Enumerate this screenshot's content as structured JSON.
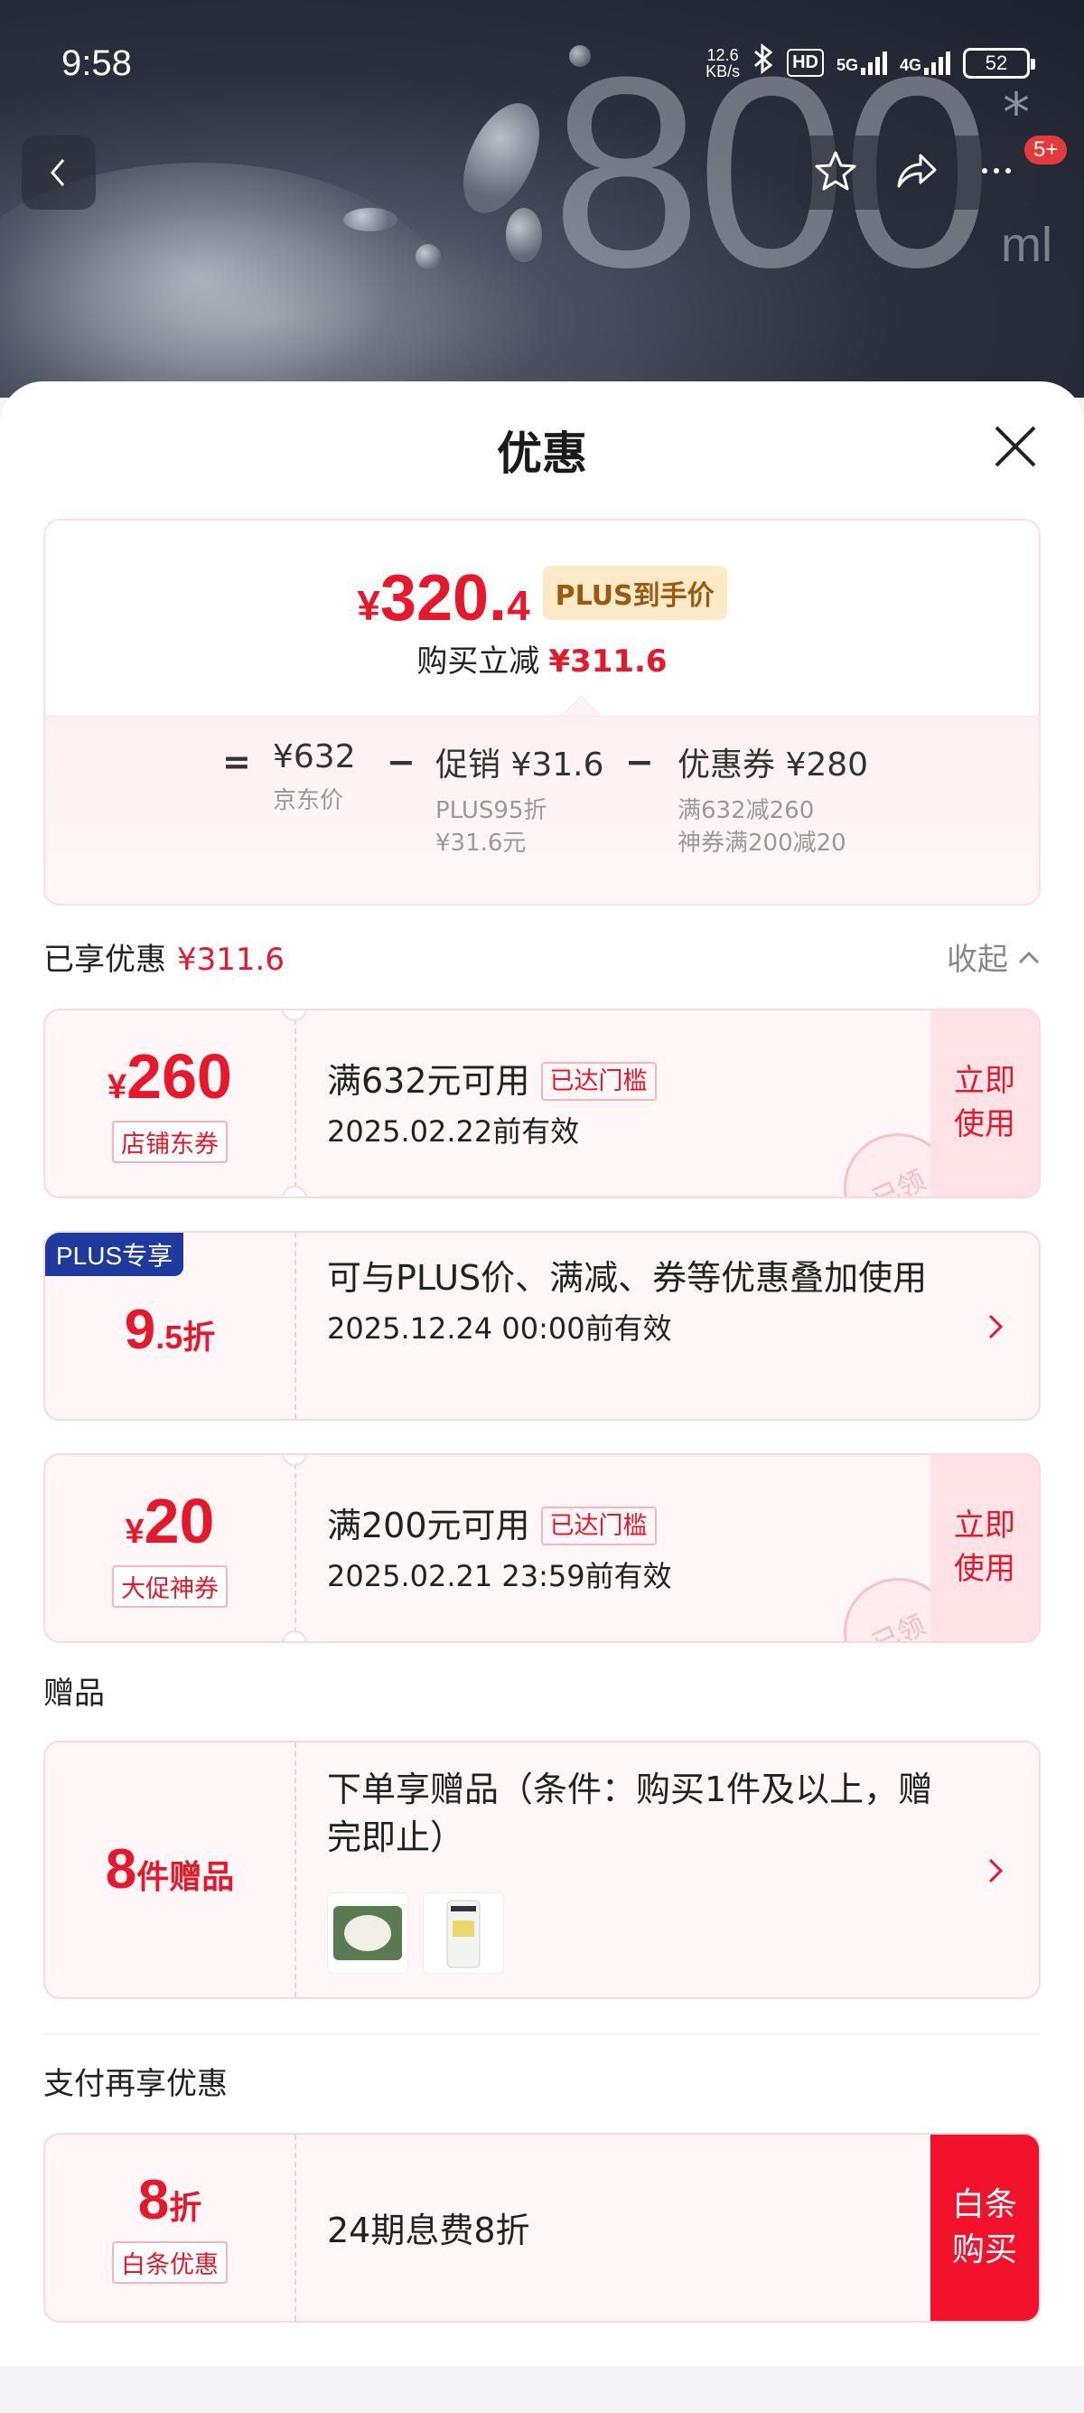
{
  "status_bar": {
    "time": "9:58",
    "net_speed_top": "12.6",
    "net_speed_unit": "KB/s",
    "hd": "HD",
    "sig1": "5G",
    "sig2": "4G",
    "battery": "52"
  },
  "hero": {
    "big_text": "800",
    "star": "*",
    "unit": "ml",
    "badge": "5+"
  },
  "sheet": {
    "title": "优惠"
  },
  "summary": {
    "price_symbol": "¥",
    "price_int": "320.",
    "price_dec": "4",
    "plus_tag": "PLUS到手价",
    "instant_label": "购买立减",
    "instant_value": "¥311.6",
    "eq": "=",
    "minus": "−",
    "jd_price": "¥632",
    "jd_price_label": "京东价",
    "promo": "促销 ¥31.6",
    "promo_sub1": "PLUS95折",
    "promo_sub2": "¥31.6元",
    "coupon": "优惠券 ¥280",
    "coupon_sub1": "满632减260",
    "coupon_sub2": "神券满200减20"
  },
  "enjoyed": {
    "label": "已享优惠",
    "value": "¥311.6",
    "collapse": "收起"
  },
  "coupons": [
    {
      "symbol": "¥",
      "amount": "260",
      "tag": "店铺东券",
      "line1": "满632元可用",
      "reached": "已达门槛",
      "line2": "2025.02.22前有效",
      "use": "立即使用",
      "stamp": "已领"
    },
    {
      "corner": "PLUS专享",
      "amount": "9",
      "amount_dec": ".5",
      "unit": "折",
      "line1": "可与PLUS价、满减、券等优惠叠加使用",
      "line2": "2025.12.24 00:00前有效"
    },
    {
      "symbol": "¥",
      "amount": "20",
      "tag": "大促神券",
      "line1": "满200元可用",
      "reached": "已达门槛",
      "line2": "2025.02.21 23:59前有效",
      "use": "立即使用",
      "stamp": "已领"
    }
  ],
  "gift": {
    "section": "赠品",
    "amount": "8",
    "unit": "件赠品",
    "line1": "下单享赠品（条件：购买1件及以上，赠完即止）"
  },
  "pay": {
    "section": "支付再享优惠",
    "amount": "8",
    "unit": "折",
    "tag": "白条优惠",
    "line1": "24期息费8折",
    "button": "白条购买"
  },
  "colors": {
    "accent": "#e5192b",
    "plus_blue": "#1f3a9e",
    "card_bg": "#fff6f7"
  }
}
